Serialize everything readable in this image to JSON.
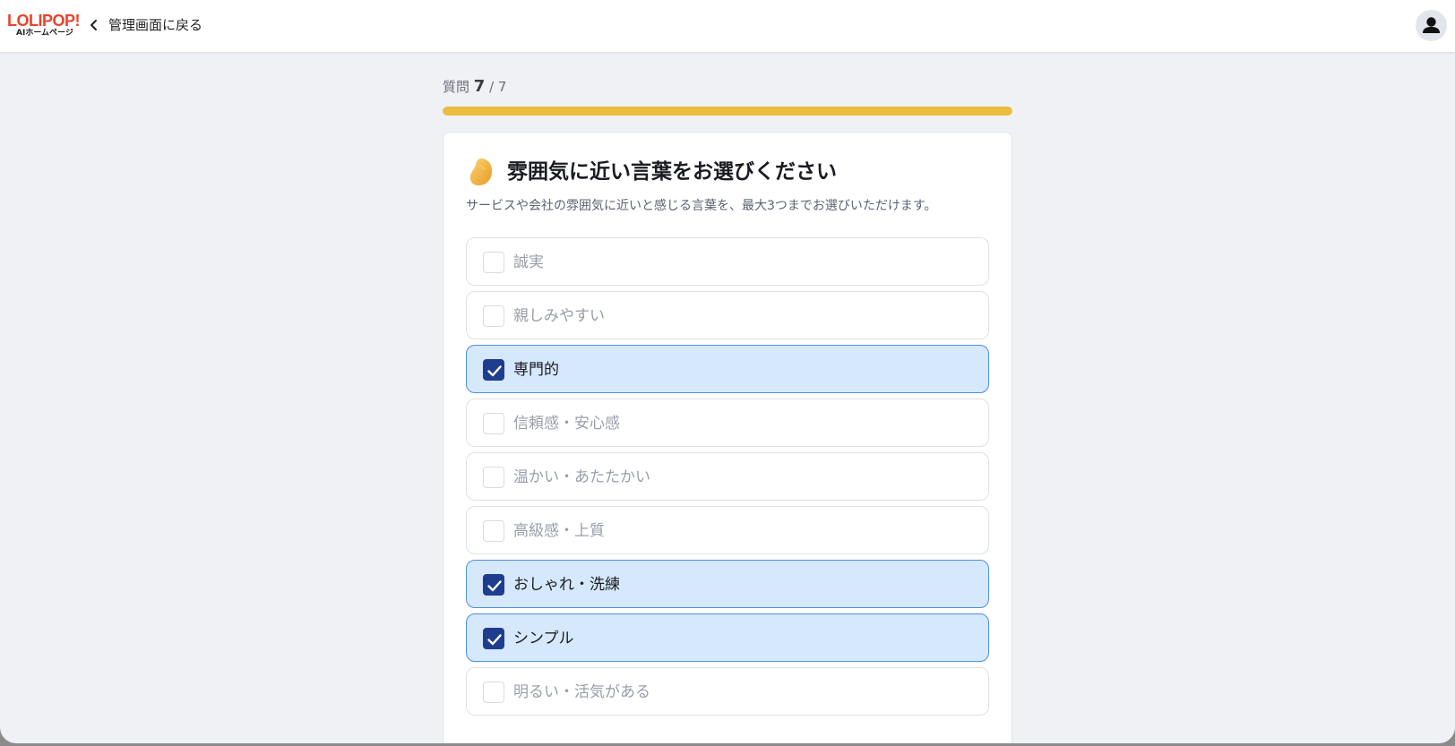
{
  "header": {
    "logo_top": "LOLIPOP!",
    "logo_bottom": "AIホームページ",
    "back_label": "管理画面に戻る"
  },
  "progress": {
    "prefix": "質問",
    "current": "7",
    "separator": "/ 7",
    "fraction": 1.0
  },
  "question": {
    "title": "雰囲気に近い言葉をお選びください",
    "description": "サービスや会社の雰囲気に近いと感じる言葉を、最大3つまでお選びいただけます。"
  },
  "options": [
    {
      "label": "誠実",
      "checked": false
    },
    {
      "label": "親しみやすい",
      "checked": false
    },
    {
      "label": "専門的",
      "checked": true
    },
    {
      "label": "信頼感・安心感",
      "checked": false
    },
    {
      "label": "温かい・あたたかい",
      "checked": false
    },
    {
      "label": "高級感・上質",
      "checked": false
    },
    {
      "label": "おしゃれ・洗練",
      "checked": true
    },
    {
      "label": "シンプル",
      "checked": true
    },
    {
      "label": "明るい・活気がある",
      "checked": false
    }
  ],
  "colors": {
    "brand": "#e8452c",
    "progress": "#ecbd3e",
    "checked_bg": "#d6e8fc",
    "checked_border": "#4c8fe6",
    "checkbox_checked": "#1f3d8f"
  }
}
